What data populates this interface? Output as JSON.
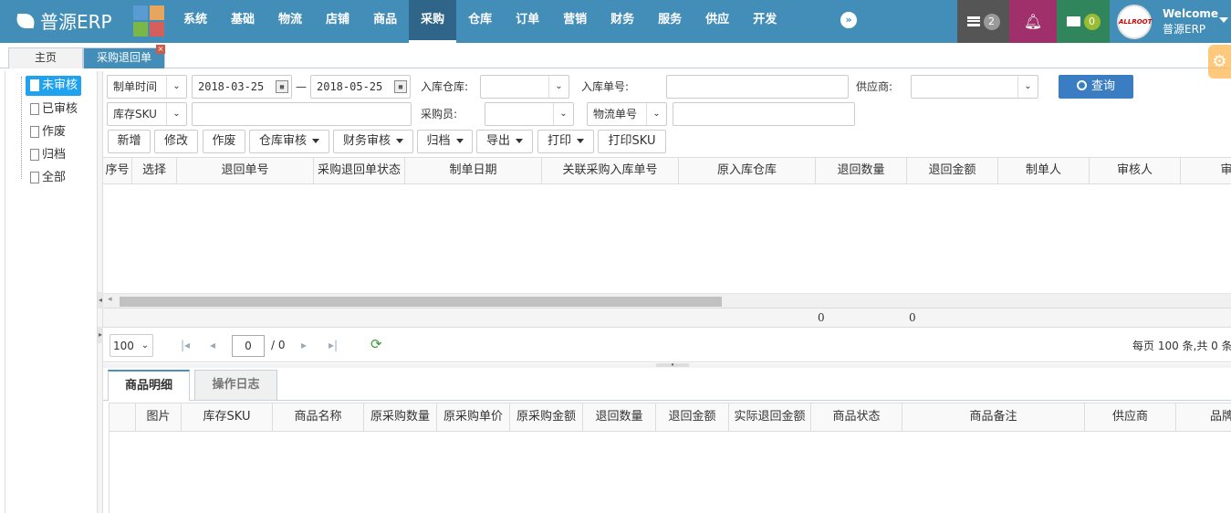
{
  "app": {
    "logo_text": "普源ERP",
    "tile_colors": [
      "#5a9bd4",
      "#e6a65d",
      "#7ab648",
      "#d45f5a"
    ]
  },
  "nav": {
    "items": [
      "系统",
      "基础",
      "物流",
      "店铺",
      "商品",
      "采购",
      "仓库",
      "订单",
      "营销",
      "财务",
      "服务",
      "供应",
      "开发"
    ],
    "active_index": 5,
    "more_label": "»"
  },
  "topbar": {
    "tasks_count": "2",
    "notify_count": "",
    "messages_count": "0",
    "colors": {
      "tasks": "#555555",
      "notify": "#a0306b",
      "messages": "#30855c",
      "bar": "#438eb9"
    }
  },
  "user": {
    "welcome": "Welcome",
    "name": "普源ERP",
    "avatar_text": "ALLROOT"
  },
  "tabs": {
    "home": "主页",
    "current": "采购退回单",
    "close": "×"
  },
  "tree": {
    "items": [
      "未审核",
      "已审核",
      "作废",
      "归档",
      "全部"
    ],
    "selected_index": 0
  },
  "filters": {
    "date_field": "制单时间",
    "date_from": "2018-03-25",
    "date_sep": "—",
    "date_to": "2018-05-25",
    "warehouse_label": "入库仓库:",
    "warehouse_value": "",
    "stockin_no_label": "入库单号:",
    "stockin_no_value": "",
    "supplier_label": "供应商:",
    "supplier_value": "",
    "query_label": "查询",
    "sku_field": "库存SKU",
    "sku_value": "",
    "buyer_label": "采购员:",
    "buyer_value": "",
    "logistics_field": "物流单号",
    "logistics_value": ""
  },
  "toolbar": {
    "add": "新增",
    "edit": "修改",
    "void": "作废",
    "warehouse_audit": "仓库审核",
    "finance_audit": "财务审核",
    "archive": "归档",
    "export": "导出",
    "print": "打印",
    "print_sku": "打印SKU"
  },
  "grid": {
    "columns": [
      "序号",
      "选择",
      "退回单号",
      "采购退回单状态",
      "制单日期",
      "关联采购入库单号",
      "原入库仓库",
      "退回数量",
      "退回金额",
      "制单人",
      "审核人",
      "审"
    ],
    "sum_qty": "0",
    "sum_amount": "0"
  },
  "pager": {
    "page_size": "100",
    "current_page": "0",
    "total_pages": "/ 0",
    "summary": "每页 100 条,共 0 条"
  },
  "detail": {
    "tabs": [
      "商品明细",
      "操作日志"
    ],
    "active_tab": 0,
    "columns": [
      "图片",
      "库存SKU",
      "商品名称",
      "原采购数量",
      "原采购单价",
      "原采购金额",
      "退回数量",
      "退回金额",
      "实际退回金额",
      "商品状态",
      "商品备注",
      "供应商",
      "品牌"
    ]
  }
}
